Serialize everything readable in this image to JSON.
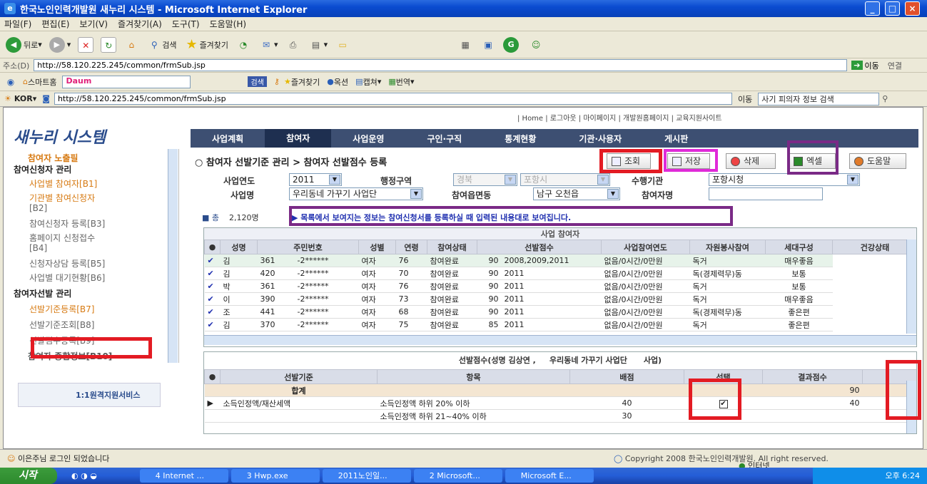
{
  "window": {
    "title": "한국노인인력개발원 새누리 시스템 - Microsoft Internet Explorer"
  },
  "menu": [
    "파일(F)",
    "편집(E)",
    "보기(V)",
    "즐겨찾기(A)",
    "도구(T)",
    "도움말(H)"
  ],
  "toolbar": {
    "back": "뒤로",
    "search": "검색",
    "favorites": "즐겨찾기"
  },
  "address": {
    "label": "주소(D)",
    "url": "http://58.120.225.245/common/frmSub.jsp",
    "go": "이동",
    "links": "연결"
  },
  "linksbar": {
    "smart_home": "스마트홈",
    "search_btn": "검색",
    "favorites": "즐겨찾기",
    "blog": "옥션",
    "capture": "캡쳐",
    "translate": "번역"
  },
  "addr2": {
    "lang": "KOR",
    "url": "http://58.120.225.245/common/frmSub.jsp",
    "go": "이동",
    "search_value": "사기 피의자 정보 검색"
  },
  "top_links": "| Home | 로그아웃 | 마이페이지 | 개발원홈페이지 | 교육지원사이트",
  "logo": "새누리 시스템",
  "nav": [
    "사업계획",
    "참여자",
    "사업운영",
    "구인·구직",
    "통계현황",
    "기관·사용자",
    "게시판"
  ],
  "sidebar": {
    "top_cut": "참여자 노출필",
    "group1": "참여신청자 관리",
    "items1": [
      "사업별 참여자[B1]",
      "기관별 참여신청자",
      "[B2]",
      "참여신청자 등록[B3]",
      "홈페이지 신청접수",
      "[B4]",
      "신청자상담 등록[B5]",
      "사업별 대기현황[B6]"
    ],
    "group2": "참여자선발 관리",
    "items2": [
      "선발기준등록[B7]",
      "선발기준조회[B8]",
      "선발점수등록[B9]"
    ],
    "group3": "참여자 종합정보[B10]",
    "banner": "1:1원격지원서비스"
  },
  "breadcrumb": "참여자 선발기준 관리 > 참여자 선발점수 등록",
  "buttons": {
    "search": "조회",
    "save": "저장",
    "delete": "삭제",
    "excel": "엑셀",
    "help": "도움말"
  },
  "form": {
    "year_label": "사업연도",
    "year_value": "2011",
    "region_label": "행정구역",
    "region1": "경북",
    "region2": "포항시",
    "agency_label": "수행기관",
    "agency_value": "포항시청",
    "project_label": "사업명",
    "project_value": "우리동네 가꾸기 사업단",
    "town_label": "참여읍면동",
    "town_value": "남구 오천읍",
    "name_label": "참여자명",
    "name_value": ""
  },
  "total": {
    "label": "총",
    "count": "2,120명",
    "notice": "목록에서 보여지는 정보는 참여신청서를 등록하실 때 입력된 내용대로 보여집니다."
  },
  "upper_table": {
    "caption": "사업 참여자",
    "headers": [
      "성명",
      "주민번호",
      "성별",
      "연령",
      "참여상태",
      "선발점수",
      "사업참여연도",
      "자원봉사참여",
      "세대구성",
      "건강상태"
    ],
    "rows": [
      [
        "김",
        "361",
        "-2******",
        "여자",
        "76",
        "참여완료",
        "90",
        "2008,2009,2011",
        "없음/0시간/0만원",
        "독거",
        "매우좋음"
      ],
      [
        "김",
        "420",
        "-2******",
        "여자",
        "70",
        "참여완료",
        "90",
        "2011",
        "없음/0시간/0만원",
        "독(경제력무)동",
        "보통"
      ],
      [
        "박",
        "361",
        "-2******",
        "여자",
        "76",
        "참여완료",
        "90",
        "2011",
        "없음/0시간/0만원",
        "독거",
        "보통"
      ],
      [
        "이",
        "390",
        "-2******",
        "여자",
        "73",
        "참여완료",
        "90",
        "2011",
        "없음/0시간/0만원",
        "독거",
        "매우좋음"
      ],
      [
        "조",
        "441",
        "-2******",
        "여자",
        "68",
        "참여완료",
        "90",
        "2011",
        "없음/0시간/0만원",
        "독(경제력무)동",
        "좋은편"
      ],
      [
        "김",
        "370",
        "-2******",
        "여자",
        "75",
        "참여완료",
        "85",
        "2011",
        "없음/0시간/0만원",
        "독거",
        "좋은편"
      ]
    ]
  },
  "lower_table": {
    "caption": "선발점수(성명 김상연 ,     우리동네 가꾸기 사업단      사업)",
    "headers": [
      "선발기준",
      "항목",
      "배점",
      "선택",
      "결과점수"
    ],
    "rows": [
      [
        "합계",
        "",
        "",
        "",
        "90"
      ],
      [
        "소득인정액/재산세액",
        "소득인정액 하위 20% 이하",
        "40",
        "✔",
        "40"
      ],
      [
        "",
        "소득인정액 하위 21~40% 이하",
        "30",
        "",
        ""
      ]
    ]
  },
  "status": {
    "login": "이은주님 로그인 되었습니다",
    "copyright": "Copyright 2008 한국노인인력개발원. All right reserved.",
    "zone": "인터넷"
  },
  "taskbar": {
    "start": "시작",
    "tasks": [
      "4 Internet ...",
      "3 Hwp.exe",
      "2011노인일...",
      "2 Microsoft...",
      "Microsoft E..."
    ],
    "clock": "오후 6:24"
  }
}
